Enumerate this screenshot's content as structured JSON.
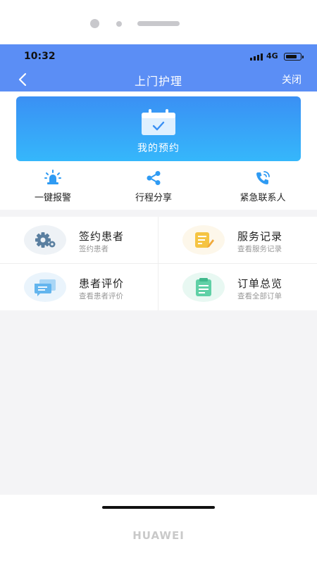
{
  "device": {
    "brand": "HUAWEI"
  },
  "status_bar": {
    "time": "10:32",
    "network": "4G"
  },
  "header": {
    "title": "上门护理",
    "close_label": "关闭"
  },
  "banner": {
    "label": "我的预约",
    "icon": "calendar-check-icon"
  },
  "quick_actions": [
    {
      "label": "一键报警",
      "icon": "alarm-siren-icon"
    },
    {
      "label": "行程分享",
      "icon": "share-icon"
    },
    {
      "label": "紧急联系人",
      "icon": "phone-call-icon"
    }
  ],
  "menu": [
    {
      "title": "签约患者",
      "subtitle": "签约患者",
      "icon": "gear-icon",
      "color": "#5a7fa0"
    },
    {
      "title": "服务记录",
      "subtitle": "查看服务记录",
      "icon": "edit-note-icon",
      "color": "#f5c443"
    },
    {
      "title": "患者评价",
      "subtitle": "查看患者评价",
      "icon": "comments-icon",
      "color": "#63b5ee"
    },
    {
      "title": "订单总览",
      "subtitle": "查看全部订单",
      "icon": "clipboard-icon",
      "color": "#5fd0a6"
    }
  ],
  "colors": {
    "header": "#5b8ef5",
    "banner_top": "#3a90f4",
    "banner_bottom": "#35b7fb",
    "accent": "#2f9bf3"
  }
}
